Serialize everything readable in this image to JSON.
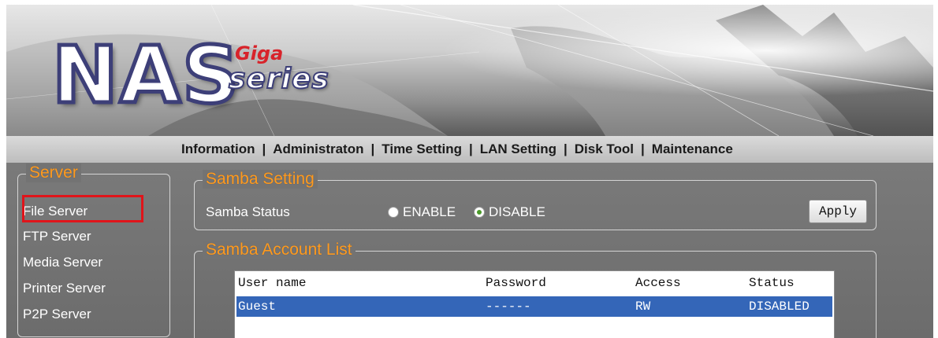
{
  "branding": {
    "logo_main": "NAS",
    "logo_giga": "Giga",
    "logo_series": "series"
  },
  "nav": {
    "items": [
      "Information",
      "Administraton",
      "Time Setting",
      "LAN Setting",
      "Disk Tool",
      "Maintenance"
    ],
    "separator": "|"
  },
  "sidebar": {
    "title": "Server",
    "items": [
      "File Server",
      "FTP Server",
      "Media Server",
      "Printer Server",
      "P2P Server"
    ],
    "highlighted_item": "File Server"
  },
  "samba_setting": {
    "title": "Samba Setting",
    "status_label": "Samba Status",
    "options": [
      "ENABLE",
      "DISABLE"
    ],
    "selected": "DISABLE",
    "apply_label": "Apply"
  },
  "account_list": {
    "title": "Samba Account List",
    "columns": [
      "User name",
      "Password",
      "Access",
      "Status"
    ],
    "rows": [
      {
        "user": "Guest",
        "password": "------",
        "access": "RW",
        "status": "DISABLED"
      }
    ]
  },
  "colors": {
    "accent_orange": "#ff9a1e",
    "highlight_red": "#e0141a",
    "selection_blue": "#3466b8",
    "panel_gray": "#737373"
  }
}
